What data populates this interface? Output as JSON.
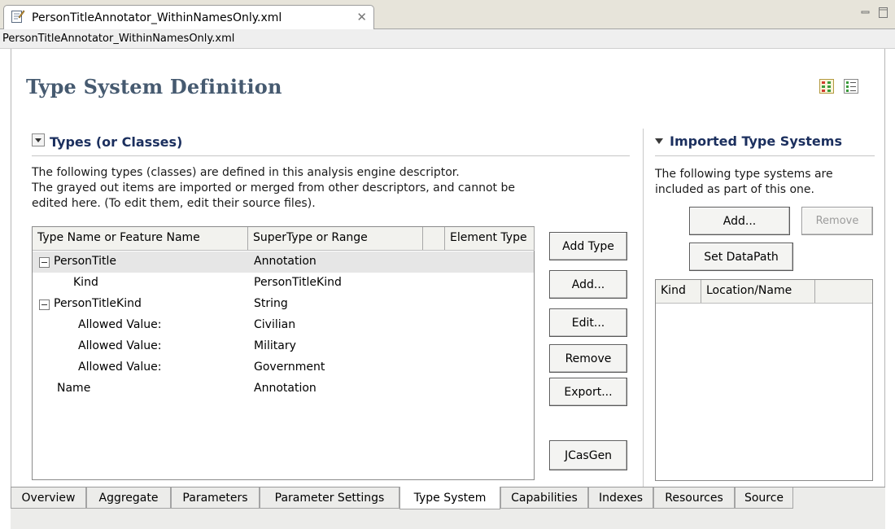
{
  "editor": {
    "tab_title": "PersonTitleAnnotator_WithinNamesOnly.xml",
    "breadcrumb": "PersonTitleAnnotator_WithinNamesOnly.xml"
  },
  "page": {
    "title": "Type System Definition"
  },
  "types_section": {
    "title": "Types (or Classes)",
    "description": [
      "The following types (classes) are defined in this analysis engine descriptor.",
      "The grayed out items are imported or merged from other descriptors, and cannot be",
      "edited here. (To edit them, edit their source files)."
    ],
    "columns": [
      "Type Name or Feature Name",
      "SuperType or Range",
      "",
      "Element Type"
    ],
    "rows": [
      {
        "name": "PersonTitle",
        "range": "Annotation",
        "expanded": true,
        "selected": true
      },
      {
        "name": "Kind",
        "range": "PersonTitleKind"
      },
      {
        "name": "PersonTitleKind",
        "range": "String",
        "expanded": true
      },
      {
        "name": "Allowed Value:",
        "range": "Civilian"
      },
      {
        "name": "Allowed Value:",
        "range": "Military"
      },
      {
        "name": "Allowed Value:",
        "range": "Government"
      },
      {
        "name": "Name",
        "range": "Annotation"
      }
    ],
    "buttons": {
      "add_type": "Add Type",
      "add": "Add...",
      "edit": "Edit...",
      "remove": "Remove",
      "export": "Export...",
      "jcasgen": "JCasGen"
    }
  },
  "imported_section": {
    "title": "Imported Type Systems",
    "description": [
      "The following type systems are",
      "included as part of this one."
    ],
    "buttons": {
      "add": "Add...",
      "remove": "Remove",
      "set_datapath": "Set DataPath"
    },
    "columns": [
      "Kind",
      "Location/Name",
      ""
    ]
  },
  "page_tabs": [
    "Overview",
    "Aggregate",
    "Parameters",
    "Parameter Settings",
    "Type System",
    "Capabilities",
    "Indexes",
    "Resources",
    "Source"
  ],
  "active_tab": "Type System",
  "colors": {
    "title": "#465a70",
    "section_title": "#1b2f5e",
    "selected_row": "#e6e6e6"
  }
}
